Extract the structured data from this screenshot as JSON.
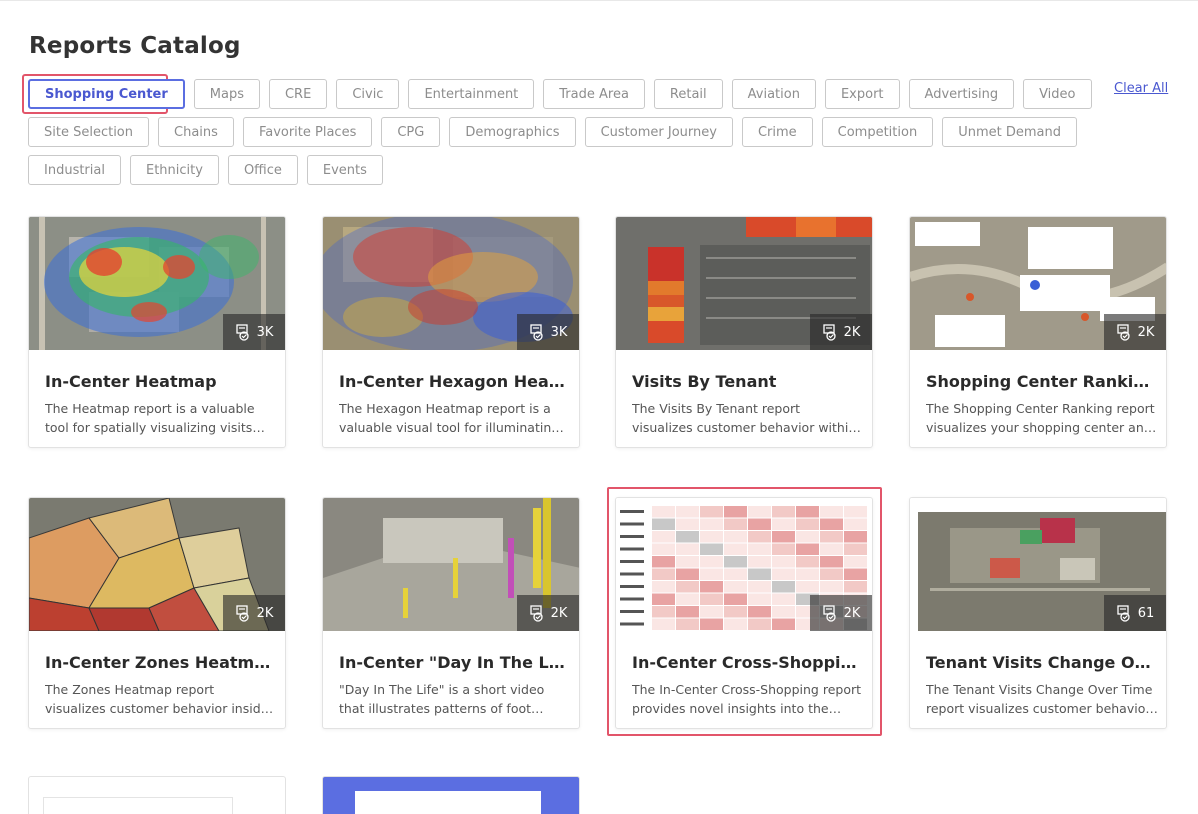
{
  "page": {
    "title": "Reports Catalog",
    "clear_all": "Clear All"
  },
  "filters": {
    "row1": [
      "Shopping Center",
      "Maps",
      "CRE",
      "Civic",
      "Entertainment",
      "Trade Area",
      "Retail",
      "Aviation",
      "Export",
      "Advertising",
      "Video"
    ],
    "row2": [
      "Site Selection",
      "Chains",
      "Favorite Places",
      "CPG",
      "Demographics",
      "Customer Journey",
      "Crime",
      "Competition",
      "Unmet Demand"
    ],
    "row3": [
      "Industrial",
      "Ethnicity",
      "Office",
      "Events"
    ],
    "active": "Shopping Center"
  },
  "cards": [
    {
      "title": "In-Center Heatmap",
      "desc": "The Heatmap report is a valuable tool for spatially visualizing visits within a shopping center.",
      "count": "3K",
      "icon": "report-stack-icon"
    },
    {
      "title": "In-Center Hexagon Heatmap",
      "desc": "The Hexagon Heatmap report is a valuable visual tool for illuminating foot traffic.",
      "count": "3K",
      "icon": "report-stack-icon"
    },
    {
      "title": "Visits By Tenant",
      "desc": "The Visits By Tenant report visualizes customer behavior within shopping centers.",
      "count": "2K",
      "icon": "report-stack-icon"
    },
    {
      "title": "Shopping Center Ranking Report",
      "desc": "The Shopping Center Ranking report visualizes your shopping center and competitors.",
      "count": "2K",
      "icon": "report-stack-icon"
    },
    {
      "title": "In-Center Zones Heatmap",
      "desc": "The Zones Heatmap report visualizes customer behavior inside any shopping center.",
      "count": "2K",
      "icon": "report-stack-icon"
    },
    {
      "title": "In-Center \"Day In The Life\" Video",
      "desc": "\"Day In The Life\" is a short video that illustrates patterns of foot traffic to a center.",
      "count": "2K",
      "icon": "report-stack-icon"
    },
    {
      "title": "In-Center Cross-Shopping",
      "desc": "The In-Center Cross-Shopping report provides novel insights into the tenant overlap.",
      "count": "2K",
      "icon": "report-stack-icon"
    },
    {
      "title": "Tenant Visits Change Over Time",
      "desc": "The Tenant Visits Change Over Time report visualizes customer behavior over time.",
      "count": "61",
      "icon": "report-stack-icon"
    }
  ],
  "colors": {
    "accent": "#4a58d0",
    "highlight": "#e2556a"
  }
}
